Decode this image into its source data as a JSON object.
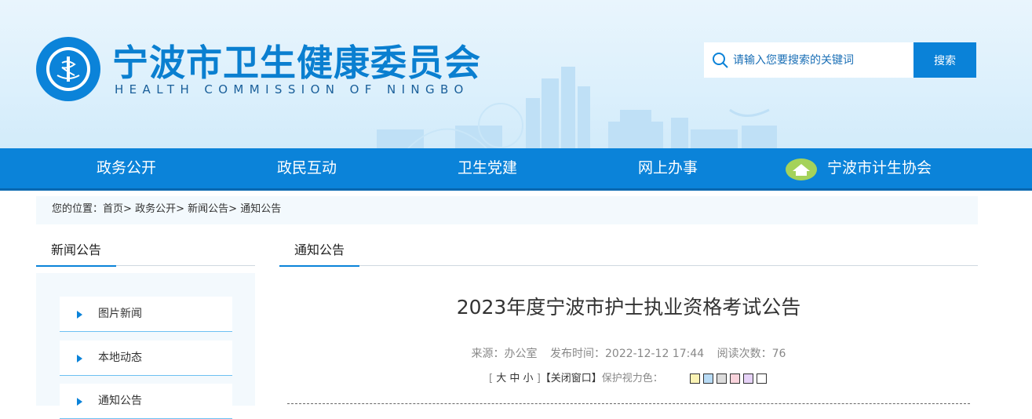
{
  "header": {
    "title": "宁波市卫生健康委员会",
    "subtitle": "HEALTH COMMISSION OF NINGBO",
    "search": {
      "placeholder": "请输入您要搜索的关键词",
      "button": "搜索"
    }
  },
  "nav": {
    "items": [
      {
        "label": "政务公开"
      },
      {
        "label": "政民互动"
      },
      {
        "label": "卫生党建"
      },
      {
        "label": "网上办事"
      },
      {
        "label": "宁波市计生协会"
      }
    ]
  },
  "breadcrumb": {
    "label": "您的位置：",
    "items": [
      "首页",
      "政务公开",
      "新闻公告",
      "通知公告"
    ],
    "separator": ">"
  },
  "sidebar": {
    "title": "新闻公告",
    "items": [
      {
        "label": "图片新闻"
      },
      {
        "label": "本地动态"
      },
      {
        "label": "通知公告"
      }
    ]
  },
  "content": {
    "section_title": "通知公告",
    "article_title": "2023年度宁波市护士执业资格考试公告",
    "meta": {
      "source": "来源：办公室",
      "published": "发布时间：2022-12-12 17:44",
      "views": "阅读次数：76"
    },
    "tools": {
      "bracket_open": "[",
      "size_large": "大",
      "size_medium": "中",
      "size_small": "小",
      "bracket_close": "]",
      "close_window": "【关闭窗口】",
      "eye_color_label": "保护视力色："
    },
    "eye_colors": [
      "#faf3b4",
      "#b8dbf5",
      "#dcdcdc",
      "#f9d3dc",
      "#e6d2f7",
      "#ffffff"
    ]
  },
  "colors": {
    "brand": "#0b83d9",
    "title": "#0a7fd0"
  }
}
